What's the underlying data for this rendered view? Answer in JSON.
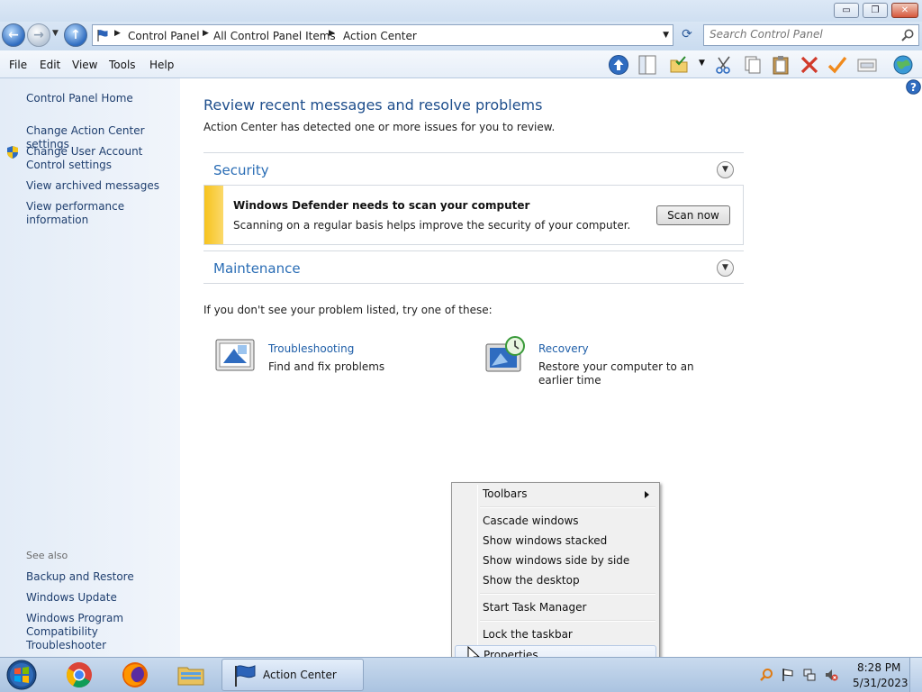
{
  "window": {
    "minimize": "▭",
    "maximize": "❐",
    "close": "✕"
  },
  "address": {
    "crumbs": [
      "Control Panel",
      "All Control Panel Items",
      "Action Center"
    ],
    "search_placeholder": "Search Control Panel"
  },
  "menu": [
    "File",
    "Edit",
    "View",
    "Tools",
    "Help"
  ],
  "left": {
    "home": "Control Panel Home",
    "links": [
      "Change Action Center settings",
      "Change User Account Control settings",
      "View archived messages",
      "View performance information"
    ],
    "see_also_title": "See also",
    "see_also": [
      "Backup and Restore",
      "Windows Update",
      "Windows Program Compatibility Troubleshooter"
    ]
  },
  "main": {
    "title": "Review recent messages and resolve problems",
    "subtitle": "Action Center has detected one or more issues for you to review.",
    "security_label": "Security",
    "maintenance_label": "Maintenance",
    "alert": {
      "title": "Windows Defender needs to scan your computer",
      "text": "Scanning on a regular basis helps improve the security of your computer.",
      "button": "Scan now"
    },
    "try_text": "If you don't see your problem listed, try one of these:",
    "tools": [
      {
        "title": "Troubleshooting",
        "desc": "Find and fix problems"
      },
      {
        "title": "Recovery",
        "desc": "Restore your computer to an earlier time"
      }
    ]
  },
  "context_menu": {
    "toolbars": "Toolbars",
    "cascade": "Cascade windows",
    "stacked": "Show windows stacked",
    "side_by_side": "Show windows side by side",
    "show_desktop": "Show the desktop",
    "task_manager": "Start Task Manager",
    "lock": "Lock the taskbar",
    "properties": "Properties"
  },
  "taskbar": {
    "active_window": "Action Center",
    "time": "8:28 PM",
    "date": "5/31/2023"
  },
  "colors": {
    "accent_link": "#1e5ea8",
    "heading": "#1e4e8c",
    "alert_stripe": "#f7c31d"
  }
}
